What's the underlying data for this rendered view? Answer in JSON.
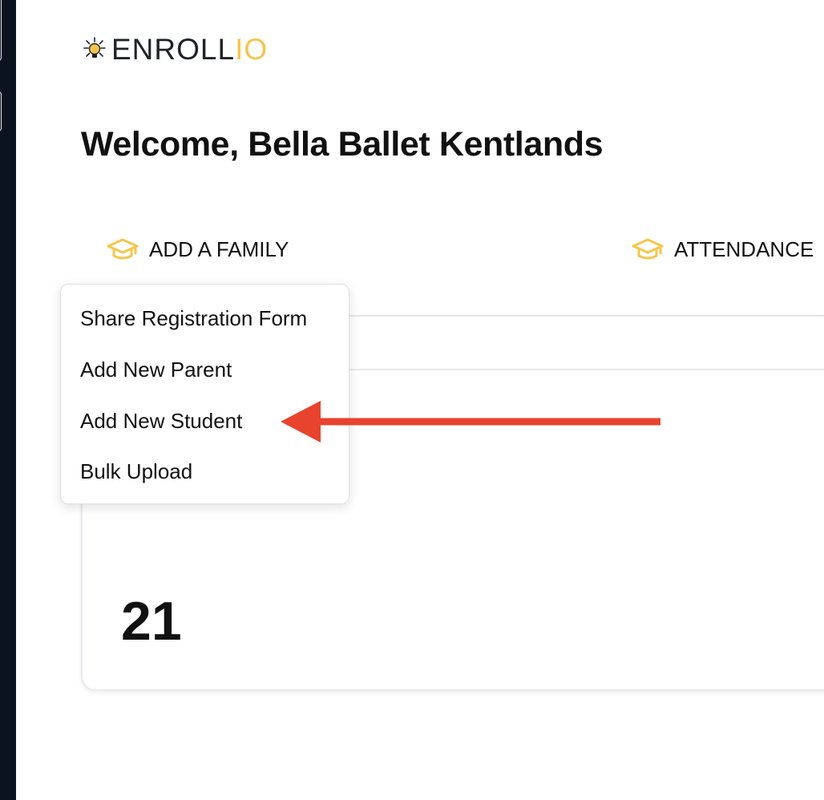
{
  "logo": {
    "text_main": "ENROLL",
    "text_accent": "IO",
    "icon": "lightbulb-icon",
    "accent_color": "#f5c64d"
  },
  "welcome": {
    "title": "Welcome, Bella Ballet Kentlands"
  },
  "nav": {
    "items": [
      {
        "label": "ADD A FAMILY",
        "icon": "graduation-cap-icon"
      },
      {
        "label": "ATTENDANCE",
        "icon": "graduation-cap-icon"
      }
    ]
  },
  "dropdown": {
    "items": [
      {
        "label": "Share Registration Form"
      },
      {
        "label": "Add New Parent"
      },
      {
        "label": "Add New Student"
      },
      {
        "label": "Bulk Upload"
      }
    ]
  },
  "stat_card": {
    "value": "21"
  },
  "colors": {
    "sidebar": "#0b1320",
    "icon_accent": "#f5c64d",
    "annotation_arrow": "#e8432d"
  }
}
